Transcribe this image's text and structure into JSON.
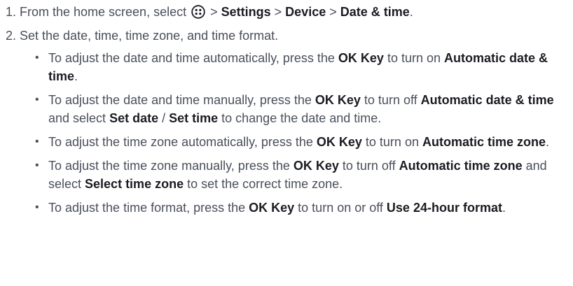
{
  "steps": [
    {
      "number": "1.",
      "parts_before_icon": "From the home screen, select",
      "icon": "apps-menu-icon",
      "parts_after_icon": [
        {
          "t": " > ",
          "b": false
        },
        {
          "t": "Settings",
          "b": true
        },
        {
          "t": " > ",
          "b": false
        },
        {
          "t": "Device",
          "b": true
        },
        {
          "t": " > ",
          "b": false
        },
        {
          "t": "Date & time",
          "b": true
        },
        {
          "t": ".",
          "b": false
        }
      ]
    },
    {
      "number": "2.",
      "text": "Set the date, time, time zone, and time format.",
      "subitems": [
        [
          {
            "t": "To adjust the date and time automatically, press the ",
            "b": false
          },
          {
            "t": "OK Key",
            "b": true
          },
          {
            "t": " to turn on ",
            "b": false
          },
          {
            "t": "Automatic date & time",
            "b": true
          },
          {
            "t": ".",
            "b": false
          }
        ],
        [
          {
            "t": "To adjust the date and time manually, press the ",
            "b": false
          },
          {
            "t": "OK Key",
            "b": true
          },
          {
            "t": " to turn off ",
            "b": false
          },
          {
            "t": "Automatic date & time",
            "b": true
          },
          {
            "t": " and select ",
            "b": false
          },
          {
            "t": "Set date",
            "b": true
          },
          {
            "t": " / ",
            "b": false
          },
          {
            "t": "Set time",
            "b": true
          },
          {
            "t": " to change the date and time.",
            "b": false
          }
        ],
        [
          {
            "t": "To adjust the time zone automatically, press the ",
            "b": false
          },
          {
            "t": "OK Key",
            "b": true
          },
          {
            "t": " to turn on ",
            "b": false
          },
          {
            "t": "Automatic time zone",
            "b": true
          },
          {
            "t": ".",
            "b": false
          }
        ],
        [
          {
            "t": "To adjust the time zone manually, press the ",
            "b": false
          },
          {
            "t": "OK Key",
            "b": true
          },
          {
            "t": " to turn off ",
            "b": false
          },
          {
            "t": "Automatic time zone",
            "b": true
          },
          {
            "t": " and select ",
            "b": false
          },
          {
            "t": "Select time zone",
            "b": true
          },
          {
            "t": " to set the correct time zone.",
            "b": false
          }
        ],
        [
          {
            "t": "To adjust the time format, press the ",
            "b": false
          },
          {
            "t": "OK Key",
            "b": true
          },
          {
            "t": " to turn on or off ",
            "b": false
          },
          {
            "t": "Use 24-hour format",
            "b": true
          },
          {
            "t": ".",
            "b": false
          }
        ]
      ]
    }
  ],
  "bullet_char": "•",
  "colors": {
    "text": "#4a4f5c",
    "bold": "#1a1c22"
  }
}
